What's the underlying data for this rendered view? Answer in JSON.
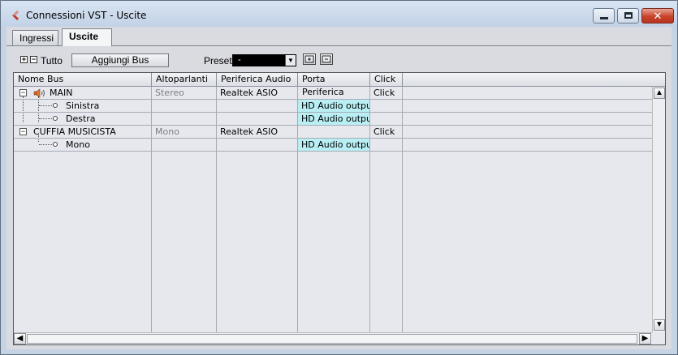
{
  "window": {
    "title": "Connessioni VST - Uscite",
    "minimize_label": "",
    "maximize_label": "",
    "close_label": "✕"
  },
  "tabs": [
    {
      "label": "Ingressi",
      "active": false
    },
    {
      "label": "Uscite",
      "active": true
    }
  ],
  "toolbar": {
    "expand_all": "+",
    "collapse_all": "−",
    "all_label": "Tutto",
    "add_bus_label": "Aggiungi Bus",
    "preset_label": "Preset",
    "preset_value": "-"
  },
  "grid": {
    "columns": [
      "Nome Bus",
      "Altoparlanti",
      "Periferica Audio",
      "Porta Periferica",
      "Click",
      ""
    ],
    "rows": [
      {
        "name": "MAIN",
        "speakers": "Stereo",
        "device": "Realtek ASIO",
        "port": "",
        "click": "Click",
        "level": 0
      },
      {
        "name": "Sinistra",
        "speakers": "",
        "device": "",
        "port": "HD Audio outpu",
        "click": "",
        "level": 1
      },
      {
        "name": "Destra",
        "speakers": "",
        "device": "",
        "port": "HD Audio outpu",
        "click": "",
        "level": 1
      },
      {
        "name": "CUFFIA MUSICISTA",
        "speakers": "Mono",
        "device": "Realtek ASIO",
        "port": "",
        "click": "Click",
        "level": 0
      },
      {
        "name": "Mono",
        "speakers": "",
        "device": "",
        "port": "HD Audio outpu",
        "click": "",
        "level": 1
      }
    ]
  },
  "colors": {
    "port_highlight": "#b9eff4",
    "window_frame": "#c5d3e4",
    "close_button": "#c7432a"
  }
}
